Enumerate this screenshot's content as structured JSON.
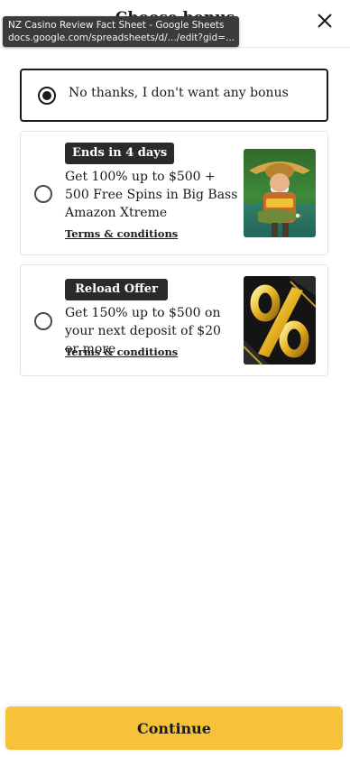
{
  "header": {
    "title": "Choose bonus"
  },
  "tooltip": {
    "title": "NZ Casino Review Fact Sheet - Google Sheets",
    "url": "docs.google.com/spreadsheets/d/.../edit?gid=..."
  },
  "options": [
    {
      "label": "No thanks, I don't want any bonus",
      "selected": true
    },
    {
      "badge": "Ends in 4 days",
      "text": "Get 100% up to $500 + 500 Free Spins in Big Bass Amazon Xtreme",
      "terms": "Terms & conditions",
      "image": "big-bass-amazon-xtreme-thumbnail",
      "selected": false
    },
    {
      "badge": "Reload Offer",
      "text": "Get 150% up to $500 on your next deposit of $20 or more",
      "terms": "Terms & conditions",
      "image": "percent-reload-thumbnail",
      "selected": false
    }
  ],
  "footer": {
    "continue_label": "Continue"
  },
  "colors": {
    "accent": "#f5c23a",
    "dark": "#1a1a1a"
  }
}
